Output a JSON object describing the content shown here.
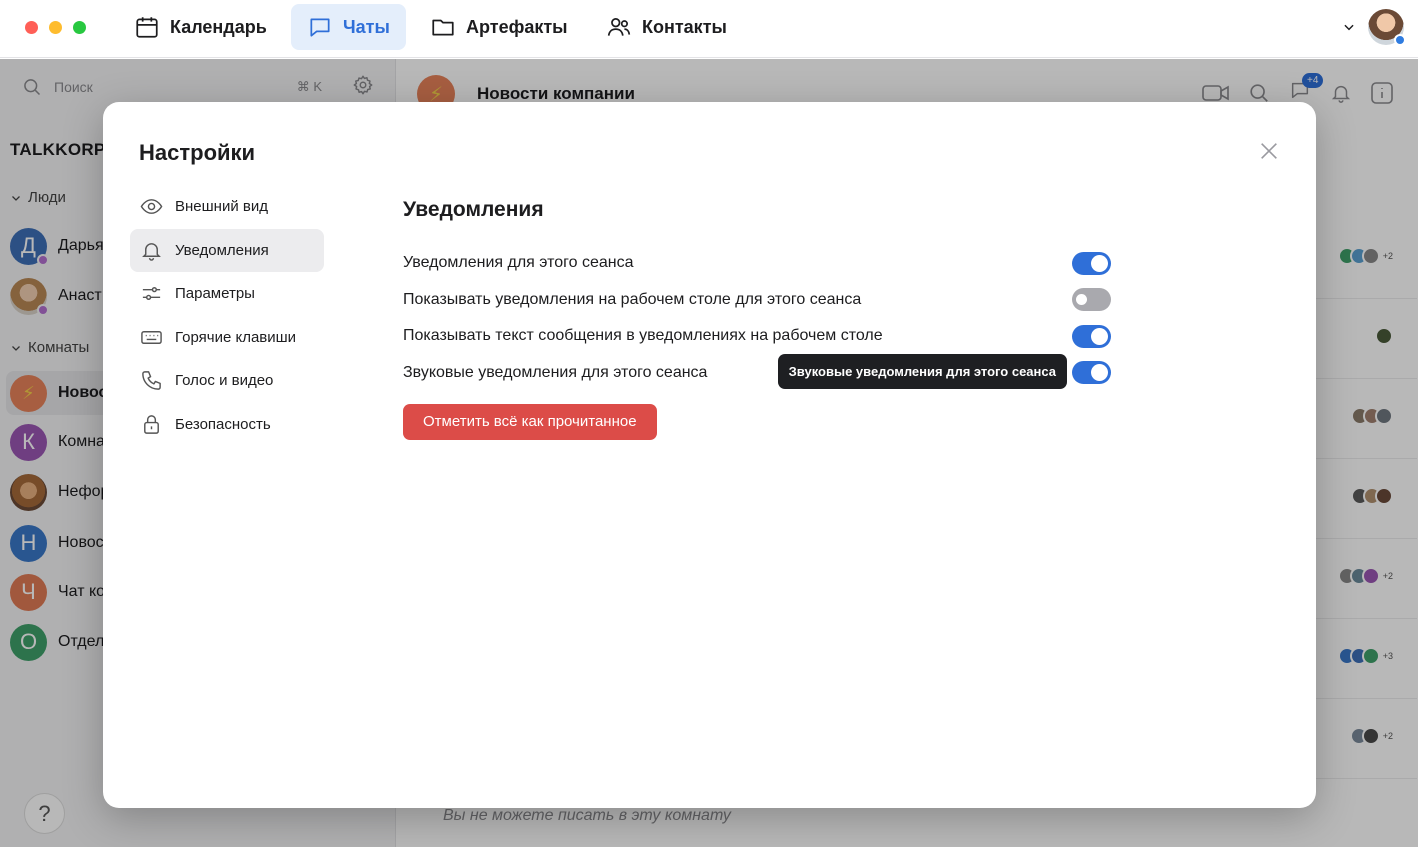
{
  "topbar": {
    "tabs": [
      {
        "label": "Календарь",
        "icon": "calendar-icon"
      },
      {
        "label": "Чаты",
        "icon": "chat-icon",
        "active": true
      },
      {
        "label": "Артефакты",
        "icon": "folder-icon"
      },
      {
        "label": "Контакты",
        "icon": "contacts-icon"
      }
    ]
  },
  "sidebar": {
    "search_placeholder": "Поиск",
    "search_shortcut": "⌘ K",
    "workspace": "TALKKORP",
    "people_label": "Люди",
    "people": [
      {
        "letter": "Д",
        "name": "Дарья",
        "color": "#3e6fb8"
      },
      {
        "name": "Анаст",
        "photo": true
      }
    ],
    "rooms_label": "Комнаты",
    "rooms": [
      {
        "letter": "⚡",
        "name": "Новос",
        "color": "#e8835a",
        "active": true
      },
      {
        "letter": "К",
        "name": "Комна",
        "color": "#9a56b3"
      },
      {
        "name": "Нефор",
        "photo": true
      },
      {
        "letter": "Н",
        "name": "Новос",
        "color": "#3a78c8"
      },
      {
        "letter": "Ч",
        "name": "Чат ко",
        "color": "#e07b55"
      },
      {
        "letter": "О",
        "name": "Отдел",
        "color": "#3fa06a"
      }
    ],
    "help": "?"
  },
  "channel": {
    "name": "Новости компании",
    "header_badge": "+4",
    "cant_write": "Вы не можете писать в эту комнату",
    "row_counts": [
      "+2",
      "",
      "",
      "",
      "+2",
      "+3",
      "+2"
    ]
  },
  "settings": {
    "title": "Настройки",
    "menu": [
      {
        "label": "Внешний вид",
        "icon": "eye-icon"
      },
      {
        "label": "Уведомления",
        "icon": "bell-icon",
        "active": true
      },
      {
        "label": "Параметры",
        "icon": "sliders-icon"
      },
      {
        "label": "Горячие клавиши",
        "icon": "keyboard-icon"
      },
      {
        "label": "Голос и видео",
        "icon": "phone-icon"
      },
      {
        "label": "Безопасность",
        "icon": "lock-icon"
      }
    ],
    "section_title": "Уведомления",
    "options": [
      {
        "label": "Уведомления для этого сеанса",
        "enabled": true
      },
      {
        "label": "Показывать уведомления на рабочем столе для этого сеанса",
        "enabled": false
      },
      {
        "label": "Показывать текст сообщения в уведомлениях на рабочем столе",
        "enabled": true
      },
      {
        "label": "Звуковые уведомления для этого сеанса",
        "enabled": true
      }
    ],
    "tooltip": "Звуковые уведомления для этого сеанса",
    "mark_all_read": "Отметить всё как прочитанное"
  },
  "colors": {
    "accent": "#2f6fd8",
    "danger": "#dc4c48"
  }
}
